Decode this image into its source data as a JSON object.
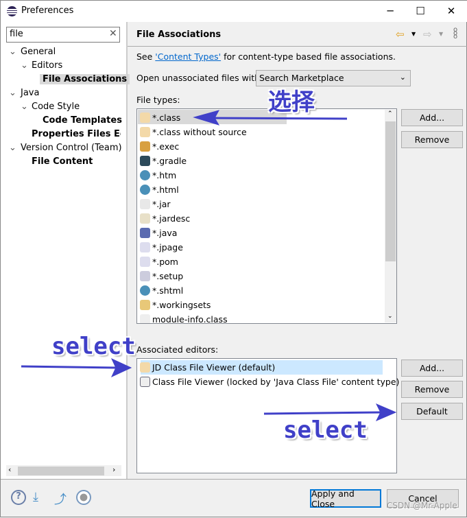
{
  "window": {
    "title": "Preferences",
    "minimize": "─",
    "maximize": "☐",
    "close": "✕"
  },
  "sidebar": {
    "search_value": "file",
    "clear": "✕",
    "tree": [
      {
        "label": "General",
        "toggle": "⌄"
      },
      {
        "label": "Editors",
        "toggle": "⌄"
      },
      {
        "label": "File Associations"
      },
      {
        "label": "Java",
        "toggle": "⌄"
      },
      {
        "label": "Code Style",
        "toggle": "⌄"
      },
      {
        "label": "Code Templates"
      },
      {
        "label": "Properties Files Edito"
      },
      {
        "label": "Version Control (Team)",
        "toggle": "⌄"
      },
      {
        "label": "File Content"
      }
    ]
  },
  "page": {
    "title": "File Associations",
    "see_prefix": "See ",
    "link": "'Content Types'",
    "see_suffix": " for content-type based file associations.",
    "open_label": "Open unassociated files with:",
    "open_value": "Search Marketplace",
    "file_types_label": "File types:",
    "file_types": [
      "*.class",
      "*.class without source",
      "*.exec",
      "*.gradle",
      "*.htm",
      "*.html",
      "*.jar",
      "*.jardesc",
      "*.java",
      "*.jpage",
      "*.pom",
      "*.setup",
      "*.shtml",
      "*.workingsets",
      "module-info.class"
    ],
    "file_type_icons": [
      "java-cup",
      "java-cup",
      "gears",
      "elephant",
      "globe",
      "globe",
      "page",
      "jar",
      "java-file",
      "j-page",
      "m-page",
      "setup",
      "globe",
      "folder",
      "binary-file"
    ],
    "ft_add": "Add...",
    "ft_remove": "Remove",
    "assoc_label": "Associated editors:",
    "editors": [
      "JD Class File Viewer (default)",
      "Class File Viewer (locked by 'Java Class File' content type)"
    ],
    "ed_add": "Add...",
    "ed_remove": "Remove",
    "ed_default": "Default"
  },
  "footer": {
    "apply_close": "Apply and Close",
    "cancel": "Cancel"
  },
  "annotations": {
    "choose": "选择",
    "select1": "select",
    "select2": "select",
    "watermark": "CSDN @Mr-Apple"
  },
  "colors": {
    "accent": "#0078d7",
    "annotation": "#4040c8",
    "selection": "#cce8ff"
  }
}
